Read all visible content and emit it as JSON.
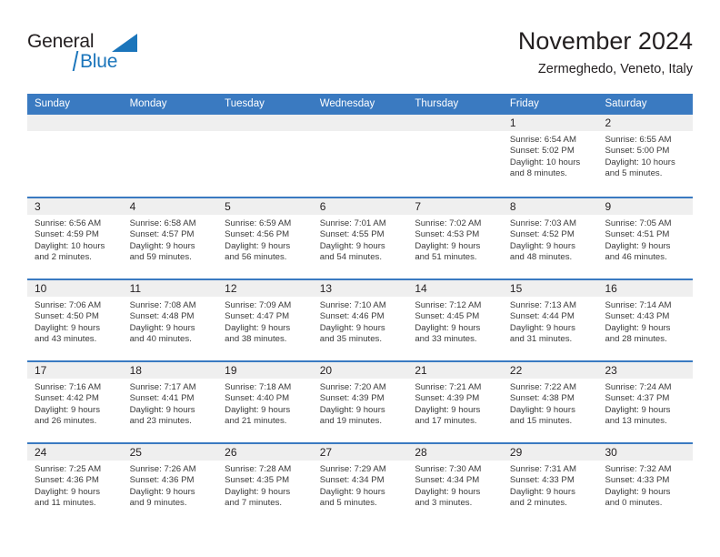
{
  "brand": {
    "word_one": "General",
    "word_two": "Blue",
    "triangle_color": "#1b75bb",
    "blue_color": "#1b75bb",
    "dark_color": "#231f20"
  },
  "header": {
    "month_title": "November 2024",
    "location": "Zermeghedo, Veneto, Italy",
    "header_bar_color": "#3a7ac1",
    "day_band_color": "#efefef"
  },
  "weekdays": [
    "Sunday",
    "Monday",
    "Tuesday",
    "Wednesday",
    "Thursday",
    "Friday",
    "Saturday"
  ],
  "labels": {
    "sunrise_prefix": "Sunrise:",
    "sunset_prefix": "Sunset:",
    "daylight_prefix": "Daylight:"
  },
  "weeks": [
    [
      {
        "empty": true
      },
      {
        "empty": true
      },
      {
        "empty": true
      },
      {
        "empty": true
      },
      {
        "empty": true
      },
      {
        "day": "1",
        "sunrise": "Sunrise: 6:54 AM",
        "sunset": "Sunset: 5:02 PM",
        "daylight_line1": "Daylight: 10 hours",
        "daylight_line2": "and 8 minutes."
      },
      {
        "day": "2",
        "sunrise": "Sunrise: 6:55 AM",
        "sunset": "Sunset: 5:00 PM",
        "daylight_line1": "Daylight: 10 hours",
        "daylight_line2": "and 5 minutes."
      }
    ],
    [
      {
        "day": "3",
        "sunrise": "Sunrise: 6:56 AM",
        "sunset": "Sunset: 4:59 PM",
        "daylight_line1": "Daylight: 10 hours",
        "daylight_line2": "and 2 minutes."
      },
      {
        "day": "4",
        "sunrise": "Sunrise: 6:58 AM",
        "sunset": "Sunset: 4:57 PM",
        "daylight_line1": "Daylight: 9 hours",
        "daylight_line2": "and 59 minutes."
      },
      {
        "day": "5",
        "sunrise": "Sunrise: 6:59 AM",
        "sunset": "Sunset: 4:56 PM",
        "daylight_line1": "Daylight: 9 hours",
        "daylight_line2": "and 56 minutes."
      },
      {
        "day": "6",
        "sunrise": "Sunrise: 7:01 AM",
        "sunset": "Sunset: 4:55 PM",
        "daylight_line1": "Daylight: 9 hours",
        "daylight_line2": "and 54 minutes."
      },
      {
        "day": "7",
        "sunrise": "Sunrise: 7:02 AM",
        "sunset": "Sunset: 4:53 PM",
        "daylight_line1": "Daylight: 9 hours",
        "daylight_line2": "and 51 minutes."
      },
      {
        "day": "8",
        "sunrise": "Sunrise: 7:03 AM",
        "sunset": "Sunset: 4:52 PM",
        "daylight_line1": "Daylight: 9 hours",
        "daylight_line2": "and 48 minutes."
      },
      {
        "day": "9",
        "sunrise": "Sunrise: 7:05 AM",
        "sunset": "Sunset: 4:51 PM",
        "daylight_line1": "Daylight: 9 hours",
        "daylight_line2": "and 46 minutes."
      }
    ],
    [
      {
        "day": "10",
        "sunrise": "Sunrise: 7:06 AM",
        "sunset": "Sunset: 4:50 PM",
        "daylight_line1": "Daylight: 9 hours",
        "daylight_line2": "and 43 minutes."
      },
      {
        "day": "11",
        "sunrise": "Sunrise: 7:08 AM",
        "sunset": "Sunset: 4:48 PM",
        "daylight_line1": "Daylight: 9 hours",
        "daylight_line2": "and 40 minutes."
      },
      {
        "day": "12",
        "sunrise": "Sunrise: 7:09 AM",
        "sunset": "Sunset: 4:47 PM",
        "daylight_line1": "Daylight: 9 hours",
        "daylight_line2": "and 38 minutes."
      },
      {
        "day": "13",
        "sunrise": "Sunrise: 7:10 AM",
        "sunset": "Sunset: 4:46 PM",
        "daylight_line1": "Daylight: 9 hours",
        "daylight_line2": "and 35 minutes."
      },
      {
        "day": "14",
        "sunrise": "Sunrise: 7:12 AM",
        "sunset": "Sunset: 4:45 PM",
        "daylight_line1": "Daylight: 9 hours",
        "daylight_line2": "and 33 minutes."
      },
      {
        "day": "15",
        "sunrise": "Sunrise: 7:13 AM",
        "sunset": "Sunset: 4:44 PM",
        "daylight_line1": "Daylight: 9 hours",
        "daylight_line2": "and 31 minutes."
      },
      {
        "day": "16",
        "sunrise": "Sunrise: 7:14 AM",
        "sunset": "Sunset: 4:43 PM",
        "daylight_line1": "Daylight: 9 hours",
        "daylight_line2": "and 28 minutes."
      }
    ],
    [
      {
        "day": "17",
        "sunrise": "Sunrise: 7:16 AM",
        "sunset": "Sunset: 4:42 PM",
        "daylight_line1": "Daylight: 9 hours",
        "daylight_line2": "and 26 minutes."
      },
      {
        "day": "18",
        "sunrise": "Sunrise: 7:17 AM",
        "sunset": "Sunset: 4:41 PM",
        "daylight_line1": "Daylight: 9 hours",
        "daylight_line2": "and 23 minutes."
      },
      {
        "day": "19",
        "sunrise": "Sunrise: 7:18 AM",
        "sunset": "Sunset: 4:40 PM",
        "daylight_line1": "Daylight: 9 hours",
        "daylight_line2": "and 21 minutes."
      },
      {
        "day": "20",
        "sunrise": "Sunrise: 7:20 AM",
        "sunset": "Sunset: 4:39 PM",
        "daylight_line1": "Daylight: 9 hours",
        "daylight_line2": "and 19 minutes."
      },
      {
        "day": "21",
        "sunrise": "Sunrise: 7:21 AM",
        "sunset": "Sunset: 4:39 PM",
        "daylight_line1": "Daylight: 9 hours",
        "daylight_line2": "and 17 minutes."
      },
      {
        "day": "22",
        "sunrise": "Sunrise: 7:22 AM",
        "sunset": "Sunset: 4:38 PM",
        "daylight_line1": "Daylight: 9 hours",
        "daylight_line2": "and 15 minutes."
      },
      {
        "day": "23",
        "sunrise": "Sunrise: 7:24 AM",
        "sunset": "Sunset: 4:37 PM",
        "daylight_line1": "Daylight: 9 hours",
        "daylight_line2": "and 13 minutes."
      }
    ],
    [
      {
        "day": "24",
        "sunrise": "Sunrise: 7:25 AM",
        "sunset": "Sunset: 4:36 PM",
        "daylight_line1": "Daylight: 9 hours",
        "daylight_line2": "and 11 minutes."
      },
      {
        "day": "25",
        "sunrise": "Sunrise: 7:26 AM",
        "sunset": "Sunset: 4:36 PM",
        "daylight_line1": "Daylight: 9 hours",
        "daylight_line2": "and 9 minutes."
      },
      {
        "day": "26",
        "sunrise": "Sunrise: 7:28 AM",
        "sunset": "Sunset: 4:35 PM",
        "daylight_line1": "Daylight: 9 hours",
        "daylight_line2": "and 7 minutes."
      },
      {
        "day": "27",
        "sunrise": "Sunrise: 7:29 AM",
        "sunset": "Sunset: 4:34 PM",
        "daylight_line1": "Daylight: 9 hours",
        "daylight_line2": "and 5 minutes."
      },
      {
        "day": "28",
        "sunrise": "Sunrise: 7:30 AM",
        "sunset": "Sunset: 4:34 PM",
        "daylight_line1": "Daylight: 9 hours",
        "daylight_line2": "and 3 minutes."
      },
      {
        "day": "29",
        "sunrise": "Sunrise: 7:31 AM",
        "sunset": "Sunset: 4:33 PM",
        "daylight_line1": "Daylight: 9 hours",
        "daylight_line2": "and 2 minutes."
      },
      {
        "day": "30",
        "sunrise": "Sunrise: 7:32 AM",
        "sunset": "Sunset: 4:33 PM",
        "daylight_line1": "Daylight: 9 hours",
        "daylight_line2": "and 0 minutes."
      }
    ]
  ]
}
